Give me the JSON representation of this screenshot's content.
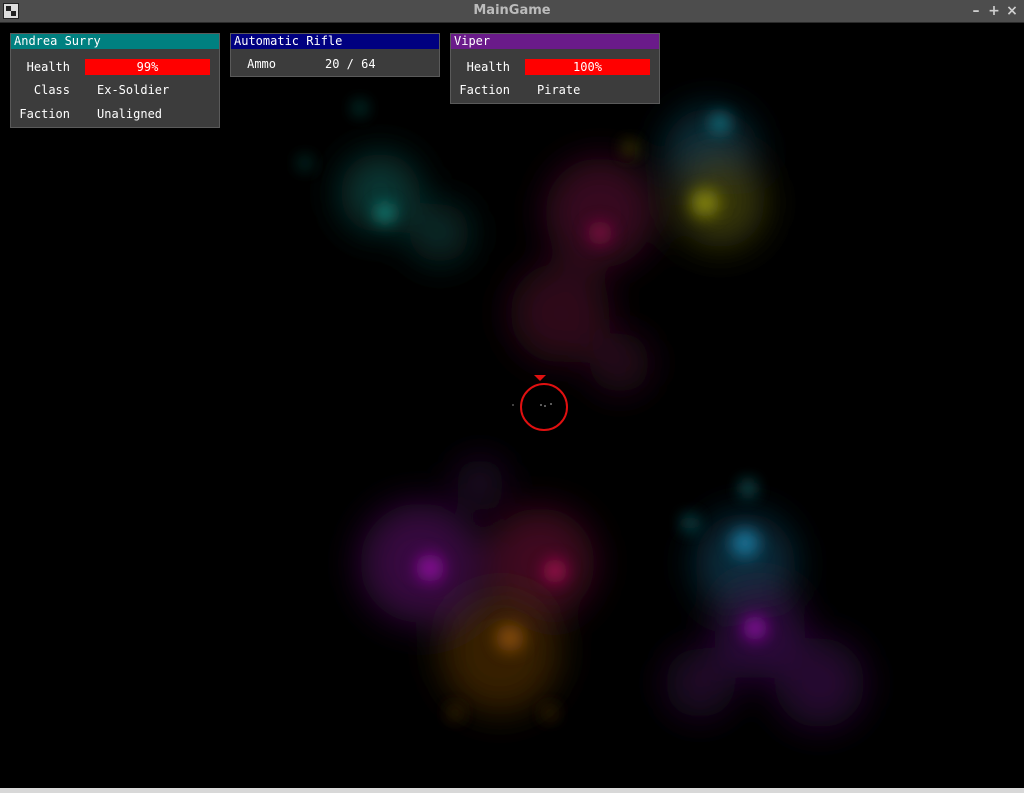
{
  "window": {
    "title": "MainGame",
    "minimize": "–",
    "maximize": "+",
    "close": "×"
  },
  "player": {
    "name": "Andrea Surry",
    "health_label": "Health",
    "health_value": "99%",
    "health_fraction": 0.99,
    "class_label": "Class",
    "class_value": "Ex-Soldier",
    "faction_label": "Faction",
    "faction_value": "Unaligned",
    "header_color": "#008080"
  },
  "weapon": {
    "name": "Automatic Rifle",
    "ammo_label": "Ammo",
    "ammo_value": "20 / 64",
    "header_color": "#000080"
  },
  "target": {
    "name": "Viper",
    "health_label": "Health",
    "health_value": "100%",
    "health_fraction": 1.0,
    "faction_label": "Faction",
    "faction_value": "Pirate",
    "header_color": "#6a1b8a"
  },
  "colors": {
    "health_bar": "#ff0000",
    "reticle": "#e01010",
    "panel_bg": "#3c3c3c"
  },
  "icons": {
    "app": "app-icon",
    "reticle": "target-reticle-icon",
    "marker": "target-marker-icon"
  }
}
